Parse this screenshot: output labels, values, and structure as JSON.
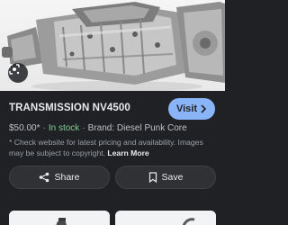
{
  "product": {
    "title": "TRANSMISSION NV4500",
    "price": "$50.00*",
    "stock": "In stock",
    "brand": "Brand: Diesel Punk Core"
  },
  "actions": {
    "visit_label": "Visit",
    "share_label": "Share",
    "save_label": "Save"
  },
  "disclaimer": {
    "text": "* Check website for latest pricing and availability. Images may be subject to copyright.",
    "learn_more": "Learn More"
  },
  "icons": {
    "lens": "lens-icon",
    "visit_arrow": "chevron-right-icon",
    "share": "share-icon",
    "save": "bookmark-icon"
  },
  "colors": {
    "background": "#202124",
    "accent": "#8ab4f8",
    "stock": "#81c995",
    "text": "#e8eaed",
    "muted": "#9aa0a6"
  }
}
